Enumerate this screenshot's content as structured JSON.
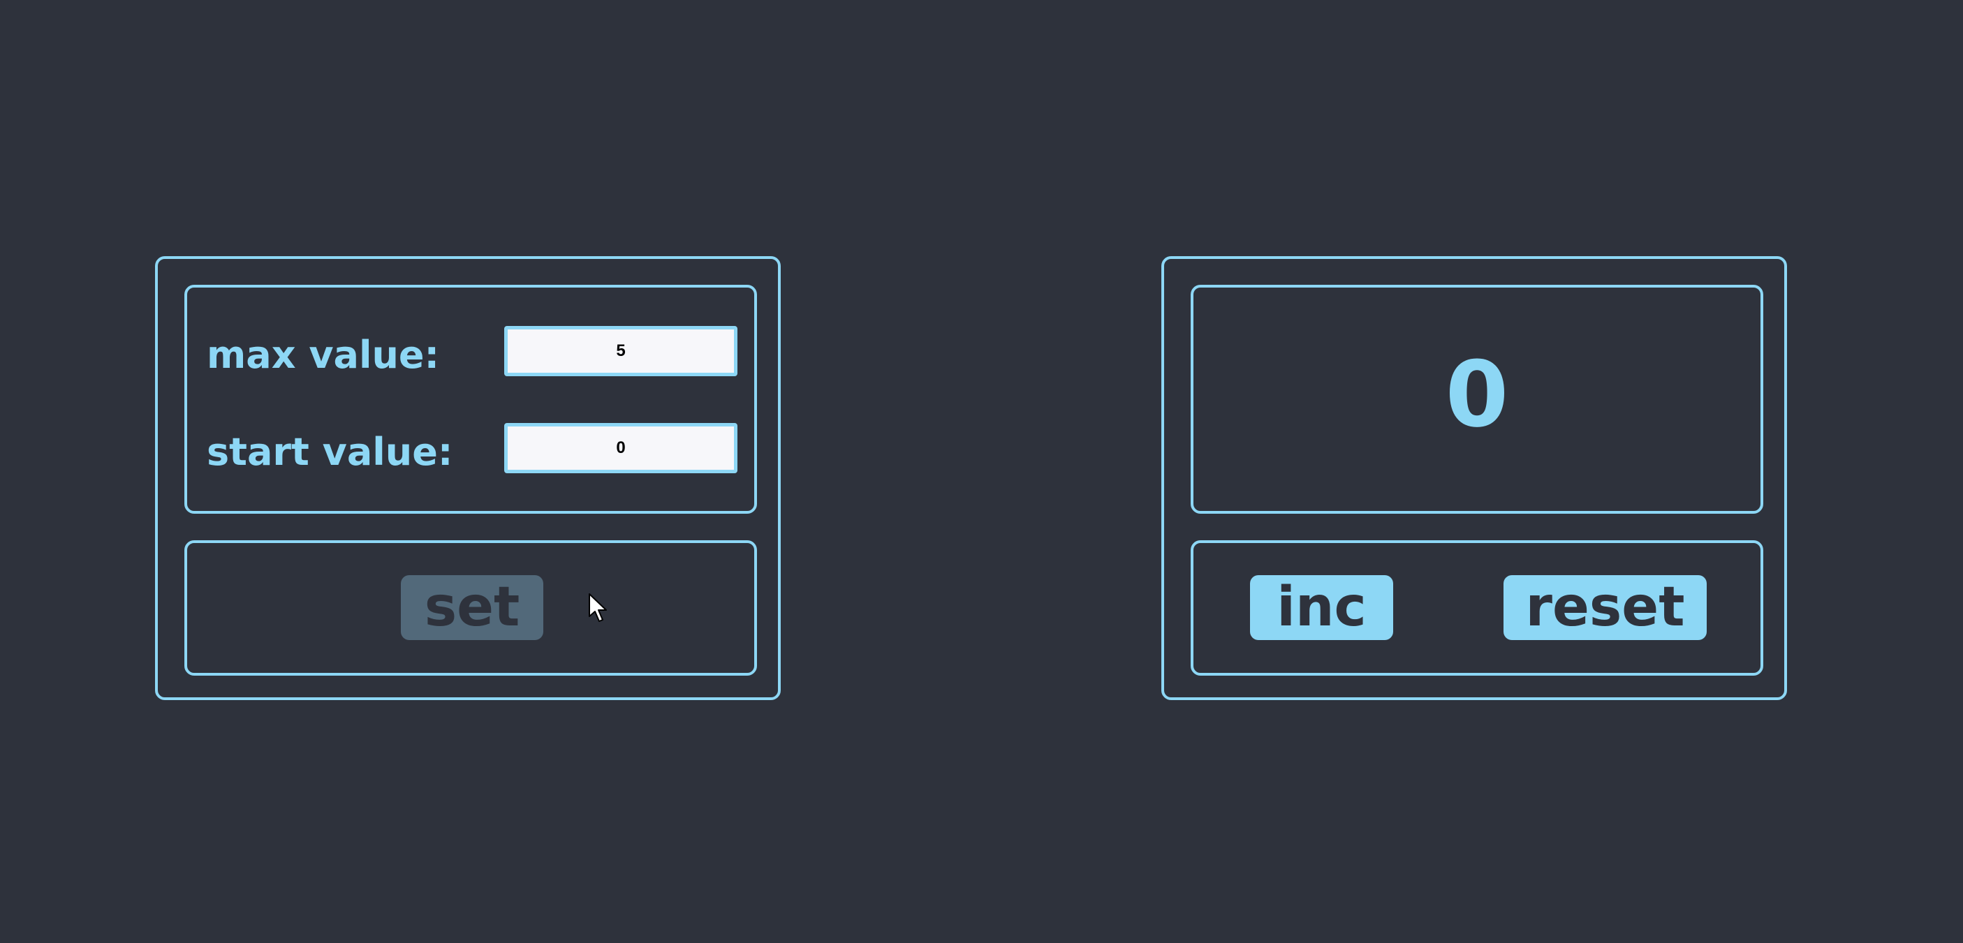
{
  "settings": {
    "max_label": "max value:",
    "max_value": "5",
    "start_label": "start value:",
    "start_value": "0",
    "set_label": "set",
    "set_disabled": true
  },
  "counter": {
    "value": "0",
    "inc_label": "inc",
    "reset_label": "reset"
  },
  "colors": {
    "background": "#2e323c",
    "accent": "#8dd7f5",
    "disabled_button": "#52697a",
    "input_background": "#f7f7fa"
  },
  "icons": {
    "cursor": "mouse-pointer-icon"
  }
}
